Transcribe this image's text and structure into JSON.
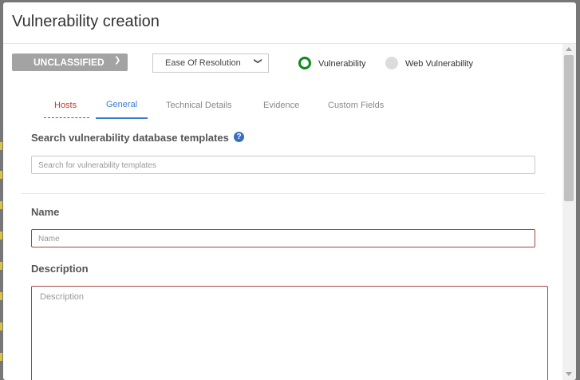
{
  "modal": {
    "title": "Vulnerability creation"
  },
  "toolbar": {
    "classification_label": "UNCLASSIFIED",
    "sort_select_value": "Ease Of Resolution",
    "radio_vulnerability_label": "Vulnerability",
    "radio_web_vulnerability_label": "Web Vulnerability",
    "selected_type": "Vulnerability"
  },
  "tabs": [
    {
      "label": "Hosts"
    },
    {
      "label": "General"
    },
    {
      "label": "Technical Details"
    },
    {
      "label": "Evidence"
    },
    {
      "label": "Custom Fields"
    }
  ],
  "active_tab": "General",
  "templates": {
    "title": "Search vulnerability database templates",
    "search_placeholder": "Search for vulnerability templates"
  },
  "form": {
    "name_label": "Name",
    "name_placeholder": "Name",
    "description_label": "Description",
    "description_placeholder": "Description"
  },
  "colors": {
    "accent": "#3a7bd5",
    "required": "#a94442",
    "radio_selected": "#0f8a1a"
  }
}
